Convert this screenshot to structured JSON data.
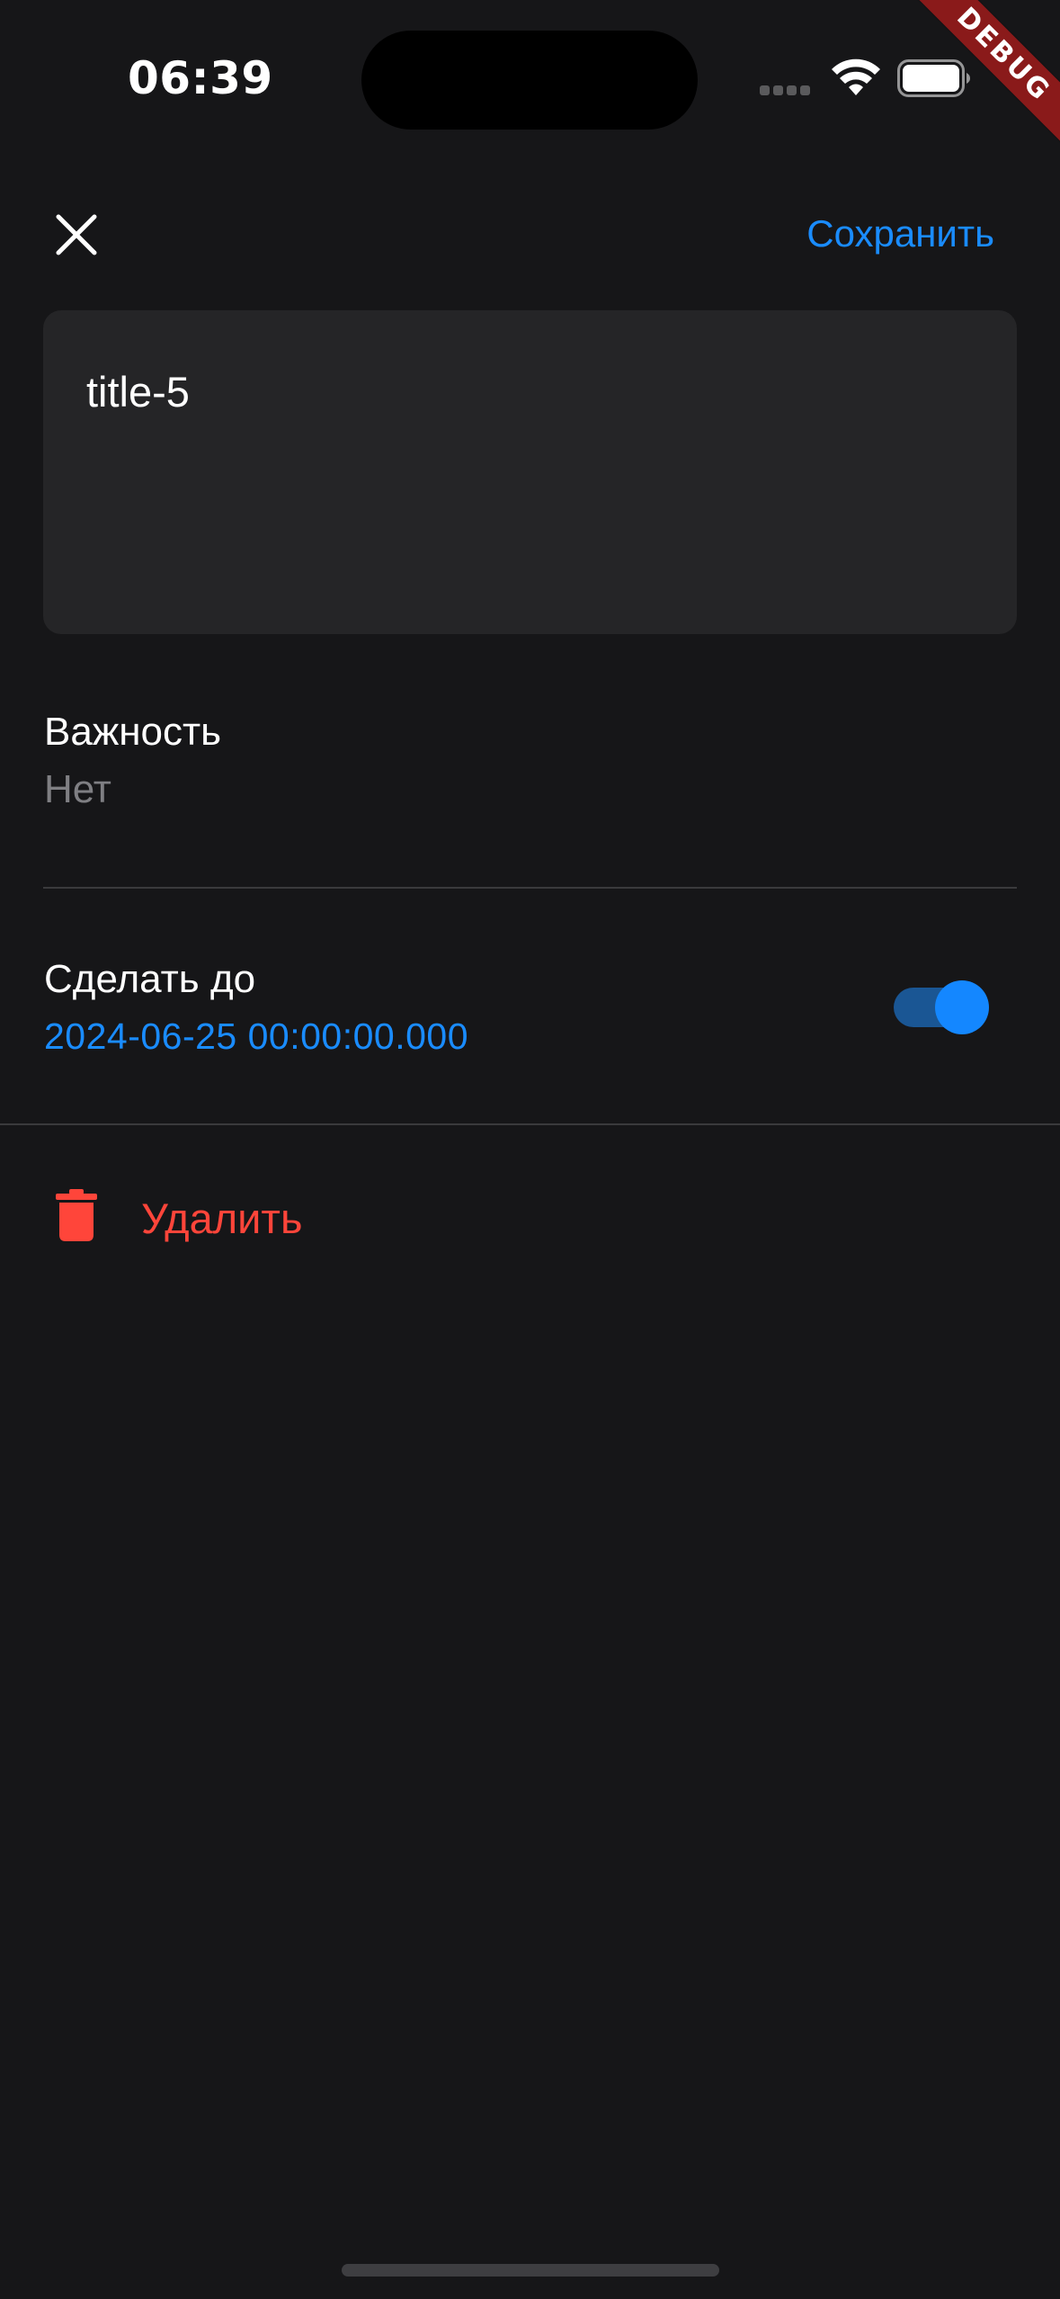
{
  "status_bar": {
    "time": "06:39",
    "signal_icon": "cellular-signal-icon",
    "wifi_icon": "wifi-icon",
    "battery_icon": "battery-icon"
  },
  "debug_banner": {
    "label": "DEBUG",
    "color": "#8a1a1a"
  },
  "top_bar": {
    "close_icon": "close-icon",
    "save_label": "Сохранить"
  },
  "task": {
    "text": "title-5"
  },
  "importance": {
    "label": "Важность",
    "value": "Нет"
  },
  "deadline": {
    "label": "Сделать до",
    "date": "2024-06-25 00:00:00.000",
    "enabled": true
  },
  "delete": {
    "icon": "trash-icon",
    "label": "Удалить"
  },
  "colors": {
    "background": "#161618",
    "card": "#252527",
    "accent": "#1a8cff",
    "danger": "#ff453a",
    "secondary_text": "#7f7f83",
    "divider": "#3a3a3c"
  }
}
